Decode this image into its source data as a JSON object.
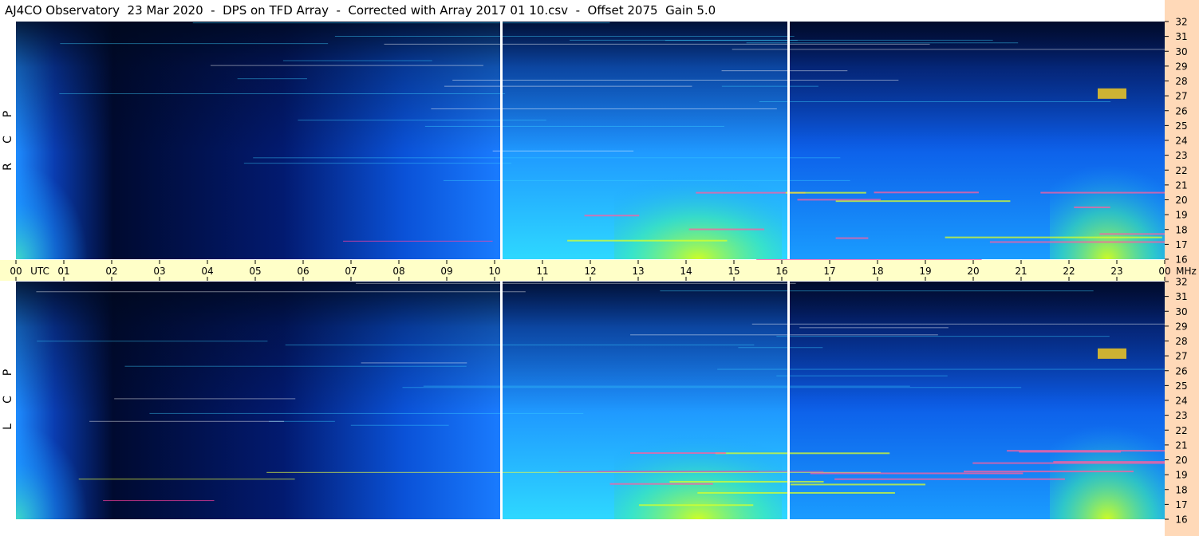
{
  "title": "AJ4CO Observatory  23 Mar 2020  -  DPS on TFD Array  -  Corrected with Array 2017 01 10.csv  -  Offset 2075  Gain 5.0",
  "colors": {
    "time_band": "#ffffc8",
    "freq_band": "#ffd9b8",
    "divider": "#ffffff",
    "spectrogram_low": "#000814",
    "spectrogram_mid": "#1c7cff",
    "spectrogram_high": "#ccff00"
  },
  "chart_data": {
    "type": "heatmap",
    "time_axis": {
      "unit_label": "UTC",
      "ticks": [
        "00",
        "01",
        "02",
        "03",
        "04",
        "05",
        "06",
        "07",
        "08",
        "09",
        "10",
        "11",
        "12",
        "13",
        "14",
        "15",
        "16",
        "17",
        "18",
        "19",
        "20",
        "21",
        "22",
        "23",
        "00"
      ],
      "range_hours": [
        0,
        24
      ]
    },
    "freq_axis": {
      "unit_label": "MHz",
      "ticks": [
        32,
        31,
        30,
        29,
        28,
        27,
        26,
        25,
        24,
        23,
        22,
        21,
        20,
        19,
        18,
        17,
        16
      ],
      "range_mhz": [
        16,
        32
      ]
    },
    "vertical_dividers_utc": [
      10.15,
      16.15
    ],
    "panels": [
      {
        "label_letters": [
          "R",
          "C",
          "P"
        ],
        "polarization": "RCP"
      },
      {
        "label_letters": [
          "L",
          "C",
          "P"
        ],
        "polarization": "LCP"
      }
    ]
  }
}
